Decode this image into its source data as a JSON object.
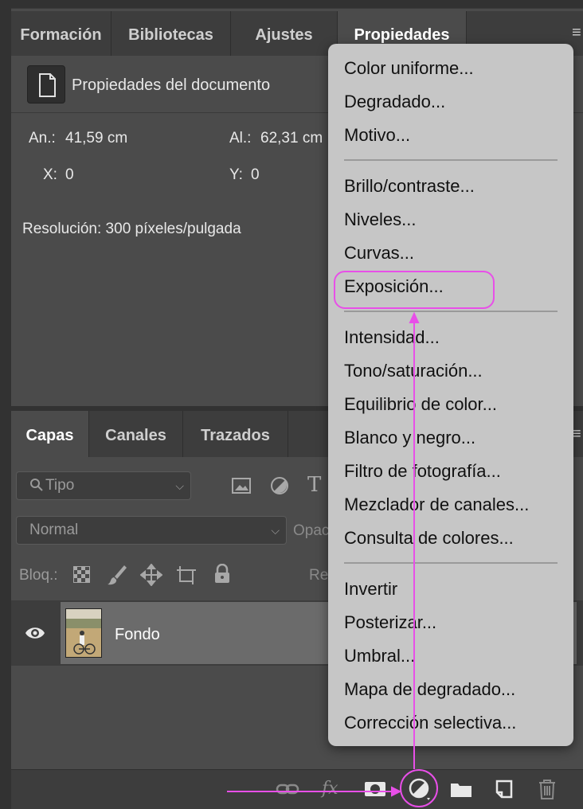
{
  "properties_panel": {
    "tabs": [
      "Formación",
      "Bibliotecas",
      "Ajustes",
      "Propiedades"
    ],
    "active_tab": "Propiedades",
    "doc_label": "Propiedades del documento",
    "width_label": "An.:",
    "width_value": "41,59 cm",
    "height_label": "Al.:",
    "height_value": "62,31 cm",
    "x_label": "X:",
    "x_value": "0",
    "y_label": "Y:",
    "y_value": "0",
    "resolution": "Resolución: 300 píxeles/pulgada"
  },
  "layers_panel": {
    "tabs": [
      "Capas",
      "Canales",
      "Trazados"
    ],
    "active_tab": "Capas",
    "filter_placeholder": "Tipo",
    "blend_mode": "Normal",
    "opacity_label": "Opac",
    "lock_label": "Bloq.:",
    "fill_label": "Re",
    "layers": [
      {
        "name": "Fondo",
        "visible": true,
        "selected": true
      }
    ]
  },
  "adjustment_menu": {
    "groups": [
      [
        "Color uniforme...",
        "Degradado...",
        "Motivo..."
      ],
      [
        "Brillo/contraste...",
        "Niveles...",
        "Curvas...",
        "Exposición..."
      ],
      [
        "Intensidad...",
        "Tono/saturación...",
        "Equilibrio de color...",
        "Blanco y negro...",
        "Filtro de fotografía...",
        "Mezclador de canales...",
        "Consulta de colores..."
      ],
      [
        "Invertir",
        "Posterizar...",
        "Umbral...",
        "Mapa de degradado...",
        "Corrección selectiva..."
      ]
    ],
    "highlighted_item": "Exposición..."
  },
  "colors": {
    "annotation": "#e84fe8",
    "menu_bg": "#c6c6c6",
    "panel_bg": "#4b4b4b",
    "tab_bg": "#3d3d3d"
  },
  "icons": {
    "document": "document-icon",
    "panel_menu": "hamburger-icon",
    "search": "search-icon",
    "filter_image": "image-filter-icon",
    "filter_adjustment": "adjustment-filter-icon",
    "filter_text": "text-filter-icon",
    "lock_pixels": "checkerboard-icon",
    "lock_paint": "brush-icon",
    "lock_move": "move-icon",
    "lock_artboard": "artboard-icon",
    "lock_all": "lock-icon",
    "visibility": "eye-icon",
    "link": "link-icon",
    "fx": "fx-icon",
    "mask": "mask-icon",
    "adjustment": "adjustment-layer-icon",
    "group": "folder-icon",
    "new_layer": "new-layer-icon",
    "delete": "trash-icon"
  }
}
